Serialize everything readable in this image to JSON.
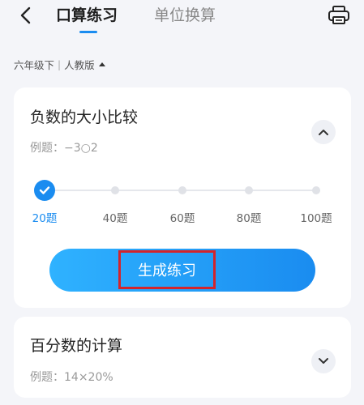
{
  "header": {
    "tabs": [
      {
        "label": "口算练习",
        "active": true
      },
      {
        "label": "单位换算",
        "active": false
      }
    ],
    "back_icon": "chevron-left-icon",
    "print_icon": "printer-icon"
  },
  "filter": {
    "grade": "六年级下",
    "separator": "|",
    "edition": "人教版"
  },
  "cards": [
    {
      "title": "负数的大小比较",
      "example": "例题：−3○2",
      "toggle_icon": "chevron-up-icon",
      "options": [
        "20题",
        "40题",
        "60题",
        "80题",
        "100题"
      ],
      "selected_index": 0,
      "button_label": "生成练习"
    },
    {
      "title": "百分数的计算",
      "example": "例题：14×20%",
      "toggle_icon": "chevron-down-icon"
    }
  ],
  "colors": {
    "accent": "#1a8cf0",
    "highlight_box": "#d3242c",
    "background": "#f4f5f9"
  }
}
